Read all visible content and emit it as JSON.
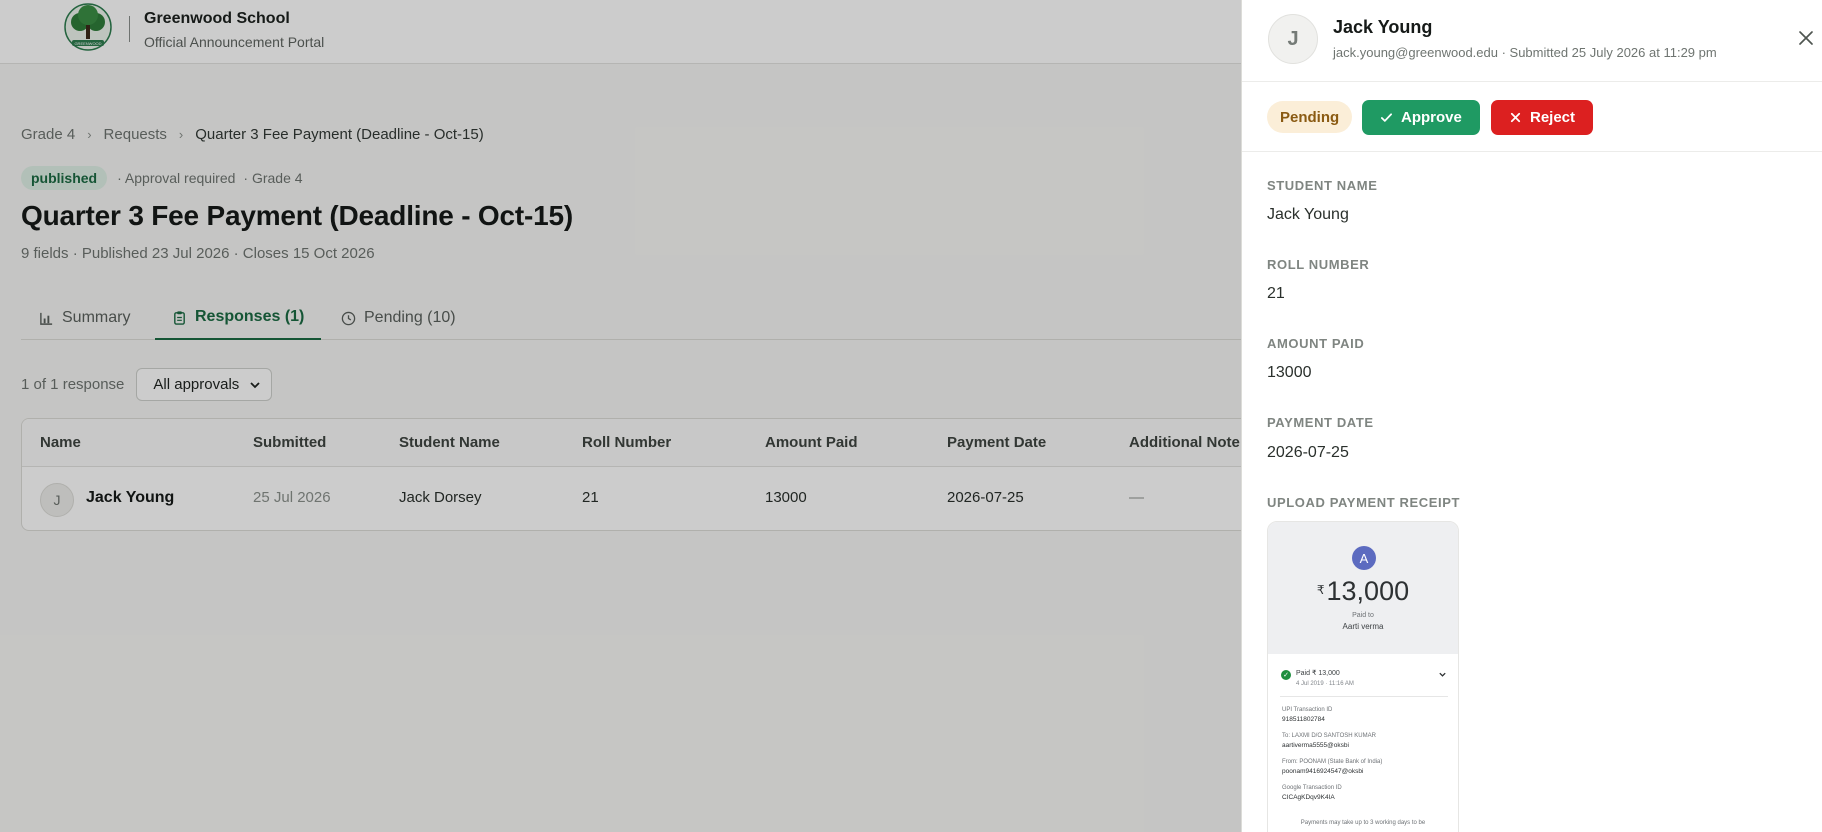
{
  "header": {
    "school_name": "Greenwood School",
    "portal_name": "Official Announcement Portal",
    "logo_text": "GREENWOOD"
  },
  "breadcrumb": [
    "Grade 4",
    "Requests",
    "Quarter 3 Fee Payment (Deadline - Oct-15)"
  ],
  "meta": {
    "status": "published",
    "approval": "· Approval required",
    "grade": "· Grade 4"
  },
  "page": {
    "title": "Quarter 3 Fee Payment (Deadline - Oct-15)",
    "subtitle": "9 fields · Published 23 Jul 2026 · Closes 15 Oct 2026"
  },
  "tabs": {
    "summary": "Summary",
    "responses": "Responses (1)",
    "pending": "Pending (10)"
  },
  "filter": {
    "count": "1 of 1 response",
    "approval_select": "All approvals"
  },
  "table": {
    "headers": [
      "Name",
      "Submitted",
      "Student Name",
      "Roll Number",
      "Amount Paid",
      "Payment Date",
      "Additional Note"
    ],
    "rows": [
      {
        "initial": "J",
        "name": "Jack Young",
        "submitted": "25 Jul 2026",
        "student_name": "Jack Dorsey",
        "roll_number": "21",
        "amount_paid": "13000",
        "payment_date": "2026-07-25",
        "note": "—"
      }
    ]
  },
  "panel": {
    "initial": "J",
    "name": "Jack Young",
    "subline": "jack.young@greenwood.edu · Submitted 25 July 2026 at 11:29 pm",
    "status": "Pending",
    "approve_label": "Approve",
    "reject_label": "Reject",
    "fields": [
      {
        "label": "STUDENT NAME",
        "value": "Jack Young"
      },
      {
        "label": "ROLL NUMBER",
        "value": "21"
      },
      {
        "label": "AMOUNT PAID",
        "value": "13000"
      },
      {
        "label": "PAYMENT DATE",
        "value": "2026-07-25"
      }
    ],
    "receipt_label": "UPLOAD PAYMENT RECEIPT"
  },
  "receipt": {
    "avatar": "A",
    "currency": "₹",
    "amount": "13,000",
    "paid_to_label": "Paid to",
    "payee": "Aarti verma",
    "status_line": "Paid ₹ 13,000",
    "status_date": "4 Jul 2019 · 11:16 AM",
    "upi_label": "UPI Transaction ID",
    "upi_value": "918511802784",
    "to_label": "To: LAXMI  D/O SANTOSH KUMAR",
    "to_value": "aartiverma5555@oksbi",
    "from_label": "From: POONAM   (State Bank of India)",
    "from_value": "poonam9416924547@oksbi",
    "gtid_label": "Google Transaction ID",
    "gtid_value": "CICAgKDqv9K4IA",
    "note": "Payments may take up to 3 working days to be"
  },
  "colors": {
    "brand_green": "#1b6b43",
    "approve": "#1f9a63",
    "reject": "#dc2020",
    "pending_bg": "#fbeed8"
  }
}
